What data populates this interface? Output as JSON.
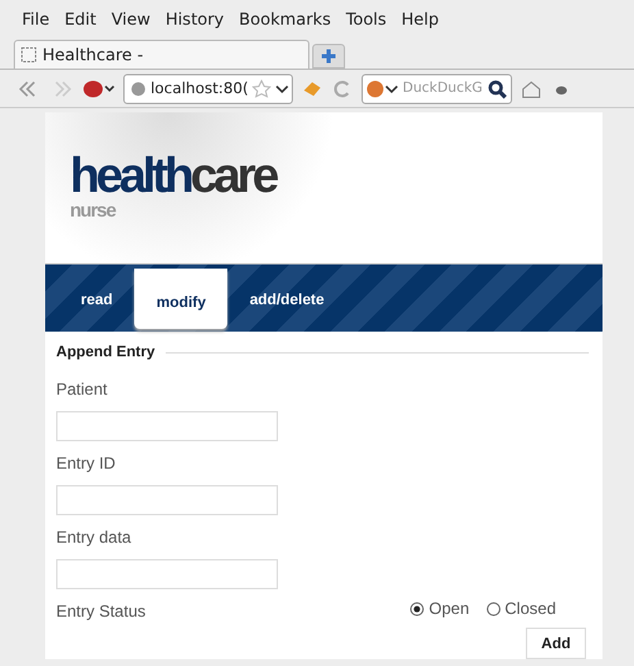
{
  "menu": [
    "File",
    "Edit",
    "View",
    "History",
    "Bookmarks",
    "Tools",
    "Help"
  ],
  "tab": {
    "title": "Healthcare -"
  },
  "url": "localhost:80(",
  "search": {
    "placeholder": "DuckDuckG"
  },
  "logo": {
    "primary": "health",
    "secondary": "care",
    "subtitle": "nurse"
  },
  "nav": [
    {
      "label": "read",
      "selected": false
    },
    {
      "label": "modify",
      "selected": true
    },
    {
      "label": "add/delete",
      "selected": false
    }
  ],
  "form": {
    "legend": "Append Entry",
    "fields": [
      {
        "label": "Patient"
      },
      {
        "label": "Entry ID"
      },
      {
        "label": "Entry data"
      }
    ],
    "status_label": "Entry Status",
    "options": [
      {
        "label": "Open",
        "selected": true
      },
      {
        "label": "Closed",
        "selected": false
      }
    ],
    "button": "Add"
  }
}
